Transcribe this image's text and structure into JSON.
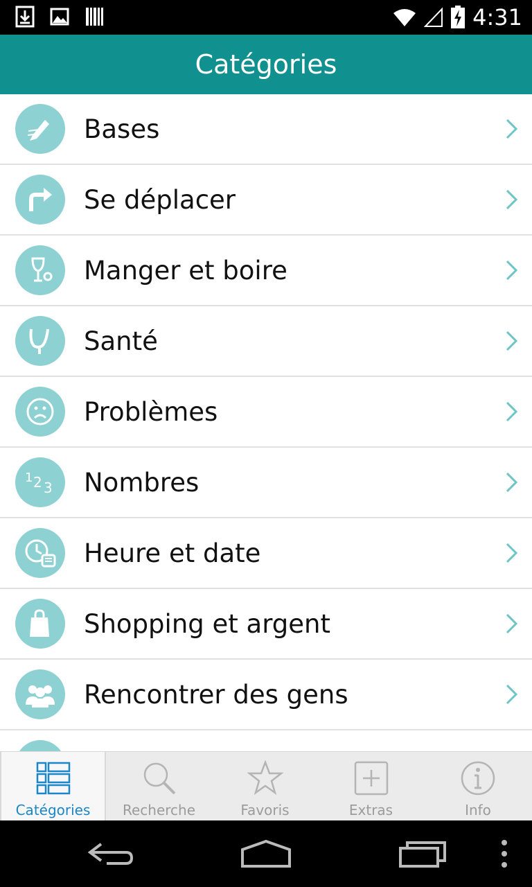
{
  "status": {
    "time": "4:31"
  },
  "header": {
    "title": "Catégories"
  },
  "categories": [
    {
      "label": "Bases",
      "icon": "pencil-icon"
    },
    {
      "label": "Se déplacer",
      "icon": "turn-arrow-icon"
    },
    {
      "label": "Manger et boire",
      "icon": "wine-glass-icon"
    },
    {
      "label": "Santé",
      "icon": "stethoscope-icon"
    },
    {
      "label": "Problèmes",
      "icon": "sad-face-icon"
    },
    {
      "label": "Nombres",
      "icon": "numbers-icon"
    },
    {
      "label": "Heure et date",
      "icon": "clock-calendar-icon"
    },
    {
      "label": "Shopping et argent",
      "icon": "shopping-bag-icon"
    },
    {
      "label": "Rencontrer des gens",
      "icon": "people-icon"
    }
  ],
  "tabs": [
    {
      "label": "Catégories",
      "icon": "list-icon",
      "active": true
    },
    {
      "label": "Recherche",
      "icon": "search-icon"
    },
    {
      "label": "Favoris",
      "icon": "star-icon"
    },
    {
      "label": "Extras",
      "icon": "plus-box-icon"
    },
    {
      "label": "Info",
      "icon": "info-icon"
    }
  ],
  "colors": {
    "accent": "#10908e",
    "icon_bg": "#8dd1d3",
    "tab_active": "#1b86c8"
  }
}
